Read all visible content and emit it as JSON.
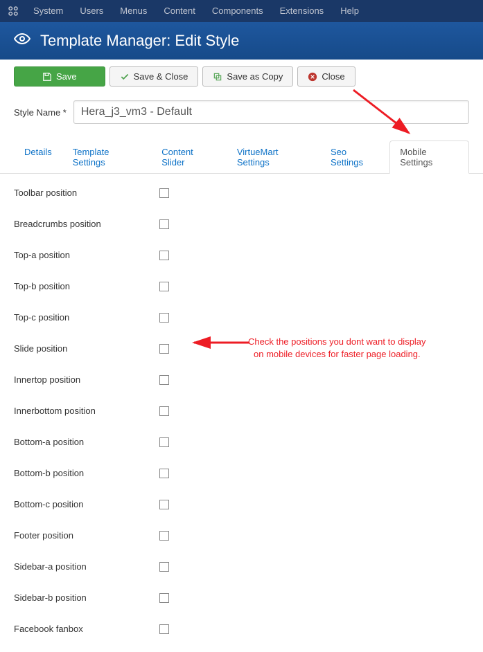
{
  "topmenu": {
    "items": [
      "System",
      "Users",
      "Menus",
      "Content",
      "Components",
      "Extensions",
      "Help"
    ]
  },
  "header": {
    "title": "Template Manager: Edit Style"
  },
  "toolbar": {
    "save": "Save",
    "save_close": "Save & Close",
    "save_copy": "Save as Copy",
    "close": "Close"
  },
  "form": {
    "style_name_label": "Style Name *",
    "style_name_value": "Hera_j3_vm3 - Default"
  },
  "tabs": {
    "items": [
      {
        "label": "Details",
        "active": false
      },
      {
        "label": "Template Settings",
        "active": false
      },
      {
        "label": "Content Slider",
        "active": false
      },
      {
        "label": "VirtueMart Settings",
        "active": false
      },
      {
        "label": "Seo Settings",
        "active": false
      },
      {
        "label": "Mobile Settings",
        "active": true
      }
    ]
  },
  "settings": {
    "rows": [
      "Toolbar position",
      "Breadcrumbs position",
      "Top-a position",
      "Top-b position",
      "Top-c position",
      "Slide position",
      "Innertop position",
      "Innerbottom position",
      "Bottom-a position",
      "Bottom-b position",
      "Bottom-c position",
      "Footer position",
      "Sidebar-a position",
      "Sidebar-b position",
      "Facebook fanbox"
    ]
  },
  "annotation": {
    "line1": "Check the positions you dont want to display",
    "line2": "on mobile devices for faster page loading."
  }
}
